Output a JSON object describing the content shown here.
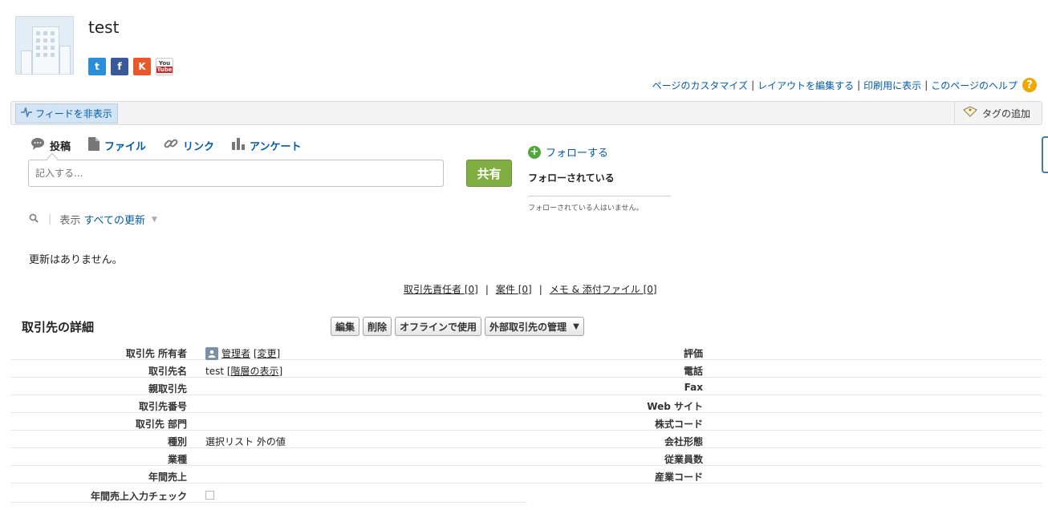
{
  "header": {
    "title": "test",
    "social": [
      {
        "name": "twitter",
        "label": "t"
      },
      {
        "name": "facebook",
        "label": "f"
      },
      {
        "name": "klout",
        "label": "K"
      },
      {
        "name": "youtube",
        "label_top": "You",
        "label_bottom": "Tube"
      }
    ]
  },
  "help_links": {
    "customize": "ページのカスタマイズ",
    "edit_layout": "レイアウトを編集する",
    "printable": "印刷用に表示",
    "help": "このページのヘルプ",
    "help_icon_glyph": "?"
  },
  "toolbar": {
    "hide_feed": "フィードを非表示",
    "add_tags": "タグの追加"
  },
  "publisher": {
    "tabs": [
      {
        "label": "投稿",
        "icon": "speech-bubble-icon"
      },
      {
        "label": "ファイル",
        "icon": "document-icon"
      },
      {
        "label": "リンク",
        "icon": "link-icon"
      },
      {
        "label": "アンケート",
        "icon": "bar-chart-icon"
      }
    ],
    "placeholder": "記入する...",
    "share": "共有"
  },
  "feed": {
    "filter_prefix": "表示",
    "filter_value": "すべての更新",
    "empty": "更新はありません。"
  },
  "follow": {
    "follow_link": "フォローする",
    "followers_heading": "フォローされている",
    "no_followers": "フォローされている人はいません。"
  },
  "related_links": [
    {
      "label": "取引先責任者",
      "count": "[0]"
    },
    {
      "label": "案件",
      "count": "[0]"
    },
    {
      "label": "メモ & 添付ファイル",
      "count": "[0]"
    }
  ],
  "detail": {
    "title": "取引先の詳細",
    "buttons": {
      "edit": "編集",
      "delete": "削除",
      "offline": "オフラインで使用",
      "external": "外部取引先の管理"
    },
    "rows": [
      {
        "label": "取引先 所有者",
        "value": "管理者",
        "link": "[変更]",
        "right_label": "評価"
      },
      {
        "label": "取引先名",
        "value": "test",
        "link": "[階層の表示]",
        "right_label": "電話"
      },
      {
        "label": "親取引先",
        "value": "",
        "right_label": "Fax"
      },
      {
        "label": "取引先番号",
        "value": "",
        "right_label": "Web サイト"
      },
      {
        "label": "取引先 部門",
        "value": "",
        "right_label": "株式コード"
      },
      {
        "label": "種別",
        "value": "選択リスト 外の値",
        "right_label": "会社形態"
      },
      {
        "label": "業種",
        "value": "",
        "right_label": "従業員数"
      },
      {
        "label": "年間売上",
        "value": "",
        "right_label": "産業コード"
      },
      {
        "label": "年間売上入力チェック",
        "value": ""
      }
    ]
  }
}
